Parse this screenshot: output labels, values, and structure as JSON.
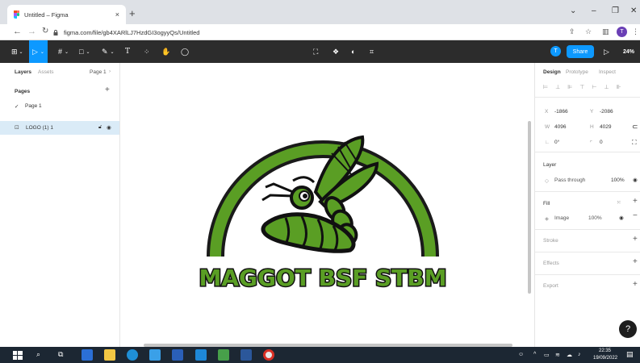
{
  "browser": {
    "tab_title": "Untitled – Figma",
    "tab_close": "×",
    "new_tab": "+",
    "window_controls": {
      "chevron": "⌄",
      "minimize": "–",
      "restore": "❐",
      "close": "✕"
    },
    "url": "figma.com/file/gb4XARlLJ7HzdGI3ogyyQs/Untitled",
    "profile_initial": "T"
  },
  "figma_toolbar": {
    "avatar_initial": "T",
    "share_label": "Share",
    "zoom_label": "24%"
  },
  "left_panel": {
    "tab_layers": "Layers",
    "tab_assets": "Assets",
    "page_selector": "Page 1",
    "pages_heading": "Pages",
    "pages": [
      "Page 1"
    ],
    "layers": [
      {
        "name": "LOGO (1) 1"
      }
    ]
  },
  "canvas": {
    "logo_text": "MAGGOT BSF STBM",
    "colors": {
      "green": "#5a9e24",
      "dark": "#1a1a1a"
    }
  },
  "right_panel": {
    "tabs": [
      "Design",
      "Prototype",
      "Inspect"
    ],
    "x_label": "X",
    "x_value": "-1866",
    "y_label": "Y",
    "y_value": "-2086",
    "w_label": "W",
    "w_value": "4096",
    "h_label": "H",
    "h_value": "4029",
    "rotation_value": "0°",
    "radius_value": "0",
    "layer_heading": "Layer",
    "blend_mode": "Pass through",
    "layer_opacity": "100%",
    "fill_heading": "Fill",
    "fill_type": "Image",
    "fill_opacity": "100%",
    "stroke_heading": "Stroke",
    "effects_heading": "Effects",
    "export_heading": "Export"
  },
  "help_label": "?",
  "taskbar": {
    "time": "22:35",
    "date": "19/09/2022"
  }
}
